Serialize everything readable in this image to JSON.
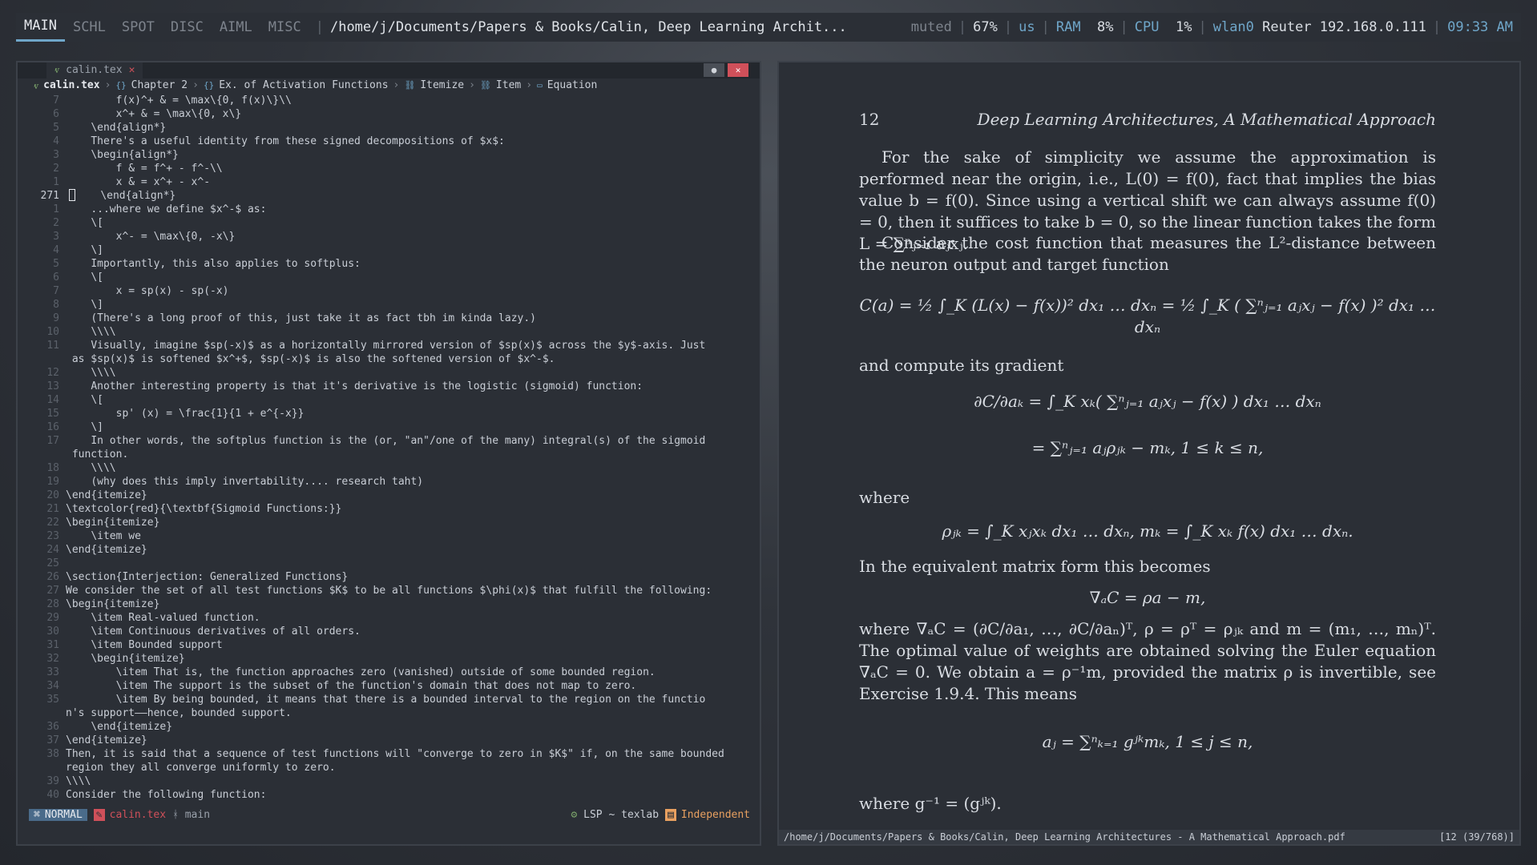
{
  "topbar": {
    "workspaces": [
      "MAIN",
      "SCHL",
      "SPOT",
      "DISC",
      "AIML",
      "MISC"
    ],
    "active_workspace": "MAIN",
    "window_title": "/home/j/Documents/Papers & Books/Calin, Deep Learning Archit...",
    "volume": "muted",
    "brightness": "67%",
    "layout": "us",
    "ram_label": "RAM",
    "ram_value": "8%",
    "cpu_label": "CPU",
    "cpu_value": "1%",
    "net_iface": "wlan0",
    "net_name": "Reuter 192.168.0.111",
    "time": "09:33 AM"
  },
  "editor": {
    "tab_label": "calin.tex",
    "breadcrumb": {
      "file": "calin.tex",
      "items": [
        "Chapter 2",
        "Ex. of Activation Functions",
        "Itemize",
        "Item",
        "Equation"
      ]
    },
    "lines": [
      {
        "n": "7",
        "text": "        f(x)^+ & = \\max\\{0, f(x)\\}\\\\"
      },
      {
        "n": "6",
        "text": "        x^+ & = \\max\\{0, x\\}"
      },
      {
        "n": "5",
        "text": "    \\end{align*}"
      },
      {
        "n": "4",
        "text": "    There's a useful identity from these signed decompositions of $x$:"
      },
      {
        "n": "3",
        "text": "    \\begin{align*}"
      },
      {
        "n": "2",
        "text": "        f & = f^+ - f^-\\\\"
      },
      {
        "n": "1",
        "text": "        x & = x^+ - x^-"
      },
      {
        "n": "271",
        "text": "    \\end{align*}",
        "current": true
      },
      {
        "n": "1",
        "text": "    ...where we define $x^-$ as:"
      },
      {
        "n": "2",
        "text": "    \\["
      },
      {
        "n": "3",
        "text": "        x^- = \\max\\{0, -x\\}"
      },
      {
        "n": "4",
        "text": "    \\]"
      },
      {
        "n": "5",
        "text": "    Importantly, this also applies to softplus:"
      },
      {
        "n": "6",
        "text": "    \\["
      },
      {
        "n": "7",
        "text": "        x = sp(x) - sp(-x)"
      },
      {
        "n": "8",
        "text": "    \\]"
      },
      {
        "n": "9",
        "text": "    (There's a long proof of this, just take it as fact tbh im kinda lazy.)"
      },
      {
        "n": "10",
        "text": "    \\\\\\\\"
      },
      {
        "n": "11",
        "text": "    Visually, imagine $sp(-x)$ as a horizontally mirrored version of $sp(x)$ across the $y$-axis. Just\n as $sp(x)$ is softened $x^+$, $sp(-x)$ is also the softened version of $x^-$.",
        "wrap": true
      },
      {
        "n": "12",
        "text": "    \\\\\\\\"
      },
      {
        "n": "13",
        "text": "    Another interesting property is that it's derivative is the logistic (sigmoid) function:"
      },
      {
        "n": "14",
        "text": "    \\["
      },
      {
        "n": "15",
        "text": "        sp' (x) = \\frac{1}{1 + e^{-x}}"
      },
      {
        "n": "16",
        "text": "    \\]"
      },
      {
        "n": "17",
        "text": "    In other words, the softplus function is the (or, \"an\"/one of the many) integral(s) of the sigmoid\n function.",
        "wrap": true
      },
      {
        "n": "18",
        "text": "    \\\\\\\\"
      },
      {
        "n": "19",
        "text": "    (why does this imply invertability.... research taht)"
      },
      {
        "n": "20",
        "text": "\\end{itemize}"
      },
      {
        "n": "21",
        "text": "\\textcolor{red}{\\textbf{Sigmoid Functions:}}"
      },
      {
        "n": "22",
        "text": "\\begin{itemize}"
      },
      {
        "n": "23",
        "text": "    \\item we"
      },
      {
        "n": "24",
        "text": "\\end{itemize}"
      },
      {
        "n": "25",
        "text": ""
      },
      {
        "n": "26",
        "text": "\\section{Interjection: Generalized Functions}"
      },
      {
        "n": "27",
        "text": "We consider the set of all test functions $K$ to be all functions $\\phi(x)$ that fulfill the following:"
      },
      {
        "n": "28",
        "text": "\\begin{itemize}"
      },
      {
        "n": "29",
        "text": "    \\item Real-valued function."
      },
      {
        "n": "30",
        "text": "    \\item Continuous derivatives of all orders."
      },
      {
        "n": "31",
        "text": "    \\item Bounded support"
      },
      {
        "n": "32",
        "text": "    \\begin{itemize}"
      },
      {
        "n": "33",
        "text": "        \\item That is, the function approaches zero (vanished) outside of some bounded region."
      },
      {
        "n": "34",
        "text": "        \\item The support is the subset of the function's domain that does not map to zero."
      },
      {
        "n": "35",
        "text": "        \\item By being bounded, it means that there is a bounded interval to the region on the functio\nn's support——hence, bounded support.",
        "wrap": true
      },
      {
        "n": "36",
        "text": "    \\end{itemize}"
      },
      {
        "n": "37",
        "text": "\\end{itemize}"
      },
      {
        "n": "38",
        "text": "Then, it is said that a sequence of test functions will \"converge to zero in $K$\" if, on the same bounded\nregion they all converge uniformly to zero.",
        "wrap": true
      },
      {
        "n": "39",
        "text": "\\\\\\\\"
      },
      {
        "n": "40",
        "text": "Consider the following function:"
      }
    ],
    "status": {
      "mode": "NORMAL",
      "file": "calin.tex",
      "branch": "main",
      "lsp": "LSP ~ texlab",
      "project": "Independent"
    }
  },
  "pdf": {
    "page_number": "12",
    "running_head": "Deep Learning Architectures, A Mathematical Approach",
    "p1": "For the sake of simplicity we assume the approximation is performed near the origin, i.e., L(0) = f(0), fact that implies the bias value b = f(0). Since using a vertical shift we can always assume f(0) = 0, then it suffices to take b = 0, so the linear function takes the form L = ∑ⁿⱼ₌₁ aⱼxⱼ.",
    "p2": "Consider the cost function that measures the L²-distance between the neuron output and target function",
    "eq1": "C(a) = ½ ∫_K (L(x) − f(x))² dx₁ … dxₙ = ½ ∫_K ( ∑ⁿⱼ₌₁ aⱼxⱼ − f(x) )² dx₁ … dxₙ",
    "p3": "and compute its gradient",
    "eq2": "∂C/∂aₖ  =  ∫_K xₖ( ∑ⁿⱼ₌₁ aⱼxⱼ − f(x) ) dx₁ … dxₙ",
    "eq3": "=  ∑ⁿⱼ₌₁ aⱼρⱼₖ − mₖ,      1 ≤ k ≤ n,",
    "p4": "where",
    "eq4": "ρⱼₖ = ∫_K xⱼxₖ dx₁ … dxₙ,      mₖ = ∫_K xₖ f(x) dx₁ … dxₙ.",
    "p5": "In the equivalent matrix form this becomes",
    "eq5": "∇ₐC = ρa − m,",
    "p6": "where ∇ₐC = (∂C/∂a₁, …, ∂C/∂aₙ)ᵀ, ρ = ρᵀ = ρⱼₖ and m = (m₁, …, mₙ)ᵀ. The optimal value of weights are obtained solving the Euler equation ∇ₐC = 0. We obtain a = ρ⁻¹m, provided the matrix ρ is invertible, see Exercise 1.9.4. This means",
    "eq6": "aⱼ = ∑ⁿₖ₌₁ gʲᵏmₖ,      1 ≤ j ≤ n,",
    "p7": "where g⁻¹ = (gʲᵏ).",
    "status_path": "/home/j/Documents/Papers & Books/Calin, Deep Learning Architectures - A Mathematical Approach.pdf",
    "status_page": "[12 (39/768)]"
  }
}
